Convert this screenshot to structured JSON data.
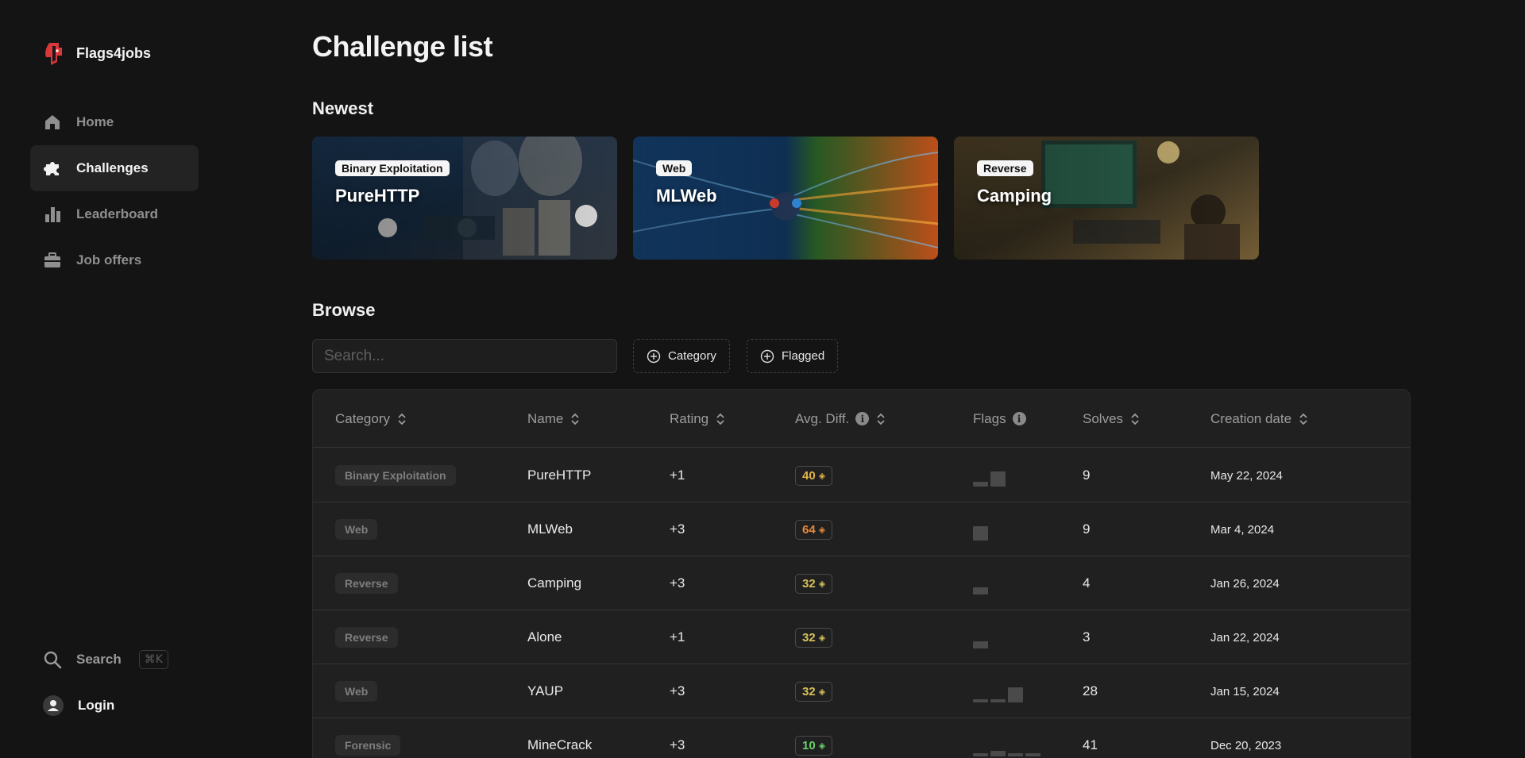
{
  "brand": {
    "name": "Flags4jobs"
  },
  "nav": [
    {
      "label": "Home",
      "icon": "home-icon",
      "active": false
    },
    {
      "label": "Challenges",
      "icon": "puzzle-icon",
      "active": true
    },
    {
      "label": "Leaderboard",
      "icon": "bar-chart-icon",
      "active": false
    },
    {
      "label": "Job offers",
      "icon": "briefcase-icon",
      "active": false
    }
  ],
  "bottom_nav": {
    "search_label": "Search",
    "search_shortcut": "⌘K",
    "login_label": "Login"
  },
  "page": {
    "title": "Challenge list",
    "newest_title": "Newest",
    "browse_title": "Browse"
  },
  "newest_cards": [
    {
      "category": "Binary Exploitation",
      "title": "PureHTTP"
    },
    {
      "category": "Web",
      "title": "MLWeb"
    },
    {
      "category": "Reverse",
      "title": "Camping"
    }
  ],
  "filters": {
    "search_placeholder": "Search...",
    "category_label": "Category",
    "flagged_label": "Flagged"
  },
  "table": {
    "columns": {
      "category": "Category",
      "name": "Name",
      "rating": "Rating",
      "avg_diff": "Avg. Diff.",
      "flags": "Flags",
      "solves": "Solves",
      "creation_date": "Creation date"
    },
    "rows": [
      {
        "category": "Binary Exploitation",
        "name": "PureHTTP",
        "rating": "+1",
        "avg_diff": "40",
        "diff_color": "#e0b44a",
        "flags": [
          0.25,
          0.85
        ],
        "solves": "9",
        "date": "May 22, 2024"
      },
      {
        "category": "Web",
        "name": "MLWeb",
        "rating": "+3",
        "avg_diff": "64",
        "diff_color": "#e8893a",
        "flags": [
          0.8
        ],
        "solves": "9",
        "date": "Mar 4, 2024"
      },
      {
        "category": "Reverse",
        "name": "Camping",
        "rating": "+3",
        "avg_diff": "32",
        "diff_color": "#d6c25a",
        "flags": [
          0.4
        ],
        "solves": "4",
        "date": "Jan 26, 2024"
      },
      {
        "category": "Reverse",
        "name": "Alone",
        "rating": "+1",
        "avg_diff": "32",
        "diff_color": "#d6c25a",
        "flags": [
          0.4
        ],
        "solves": "3",
        "date": "Jan 22, 2024"
      },
      {
        "category": "Web",
        "name": "YAUP",
        "rating": "+3",
        "avg_diff": "32",
        "diff_color": "#d6c25a",
        "flags": [
          0.2,
          0.2,
          0.85
        ],
        "solves": "28",
        "date": "Jan 15, 2024"
      },
      {
        "category": "Forensic",
        "name": "MineCrack",
        "rating": "+3",
        "avg_diff": "10",
        "diff_color": "#6ad06a",
        "flags": [
          0.2,
          0.3,
          0.2,
          0.2
        ],
        "solves": "41",
        "date": "Dec 20, 2023"
      }
    ]
  }
}
